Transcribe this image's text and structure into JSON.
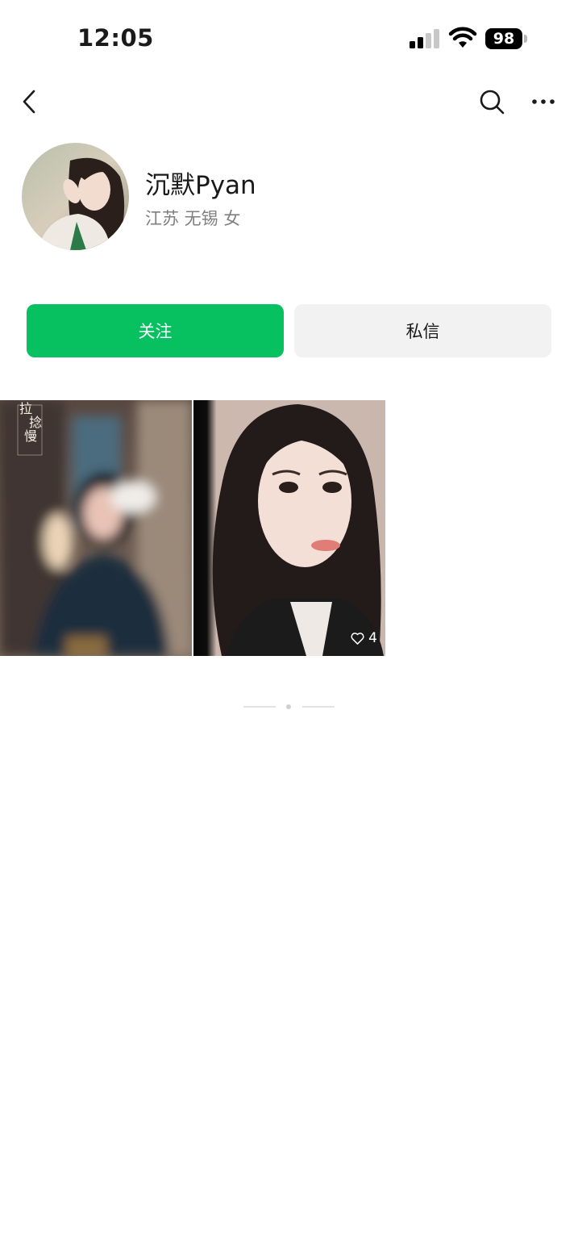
{
  "status_bar": {
    "time": "12:05",
    "battery": "98",
    "icons": [
      "cellular-signal-icon",
      "wifi-icon",
      "battery-icon"
    ]
  },
  "nav": {
    "icons": [
      "chevron-left-icon",
      "search-icon",
      "more-horizontal-icon"
    ]
  },
  "profile": {
    "name": "沉默Pyan",
    "meta": "江苏 无锡 女"
  },
  "actions": {
    "follow_label": "关注",
    "message_label": "私信"
  },
  "posts": [
    {
      "overlay_text": [
        "拉",
        "捻",
        "慢"
      ],
      "likes": null
    },
    {
      "overlay_text": [],
      "likes": "4"
    }
  ],
  "colors": {
    "accent": "#07c160",
    "secondary_button": "#f2f2f2",
    "meta_text": "#7f7f7f",
    "divider": "#d8d8d8"
  }
}
